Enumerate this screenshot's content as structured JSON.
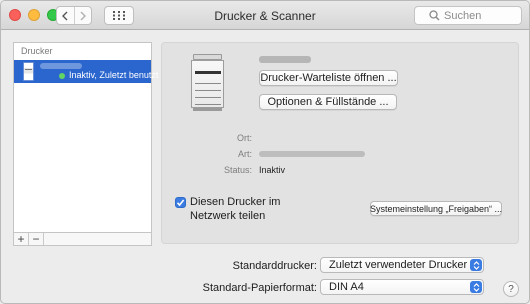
{
  "window": {
    "title": "Drucker & Scanner"
  },
  "toolbar": {
    "search_placeholder": "Suchen"
  },
  "sidebar": {
    "header": "Drucker",
    "printers": [
      {
        "status": "Inaktiv, Zuletzt benutzt",
        "status_color": "#62d463",
        "selected": true
      }
    ],
    "add_label": "+",
    "remove_label": "−"
  },
  "detail": {
    "queue_button": "Drucker-Warteliste öffnen ...",
    "options_button": "Optionen & Füllstände ...",
    "location_label": "Ort:",
    "kind_label": "Art:",
    "status_label": "Status:",
    "status_value": "Inaktiv",
    "share_label": "Diesen Drucker im Netzwerk teilen",
    "share_checked": true,
    "sharing_prefs_button": "Systemeinstellung „Freigaben“ ..."
  },
  "footer": {
    "default_printer_label": "Standarddrucker:",
    "default_printer_value": "Zuletzt verwendeter Drucker",
    "paper_label": "Standard-Papierformat:",
    "paper_value": "DIN A4",
    "help_label": "?"
  },
  "colors": {
    "selection": "#2b66cf",
    "accent": "#3a7ce2"
  }
}
